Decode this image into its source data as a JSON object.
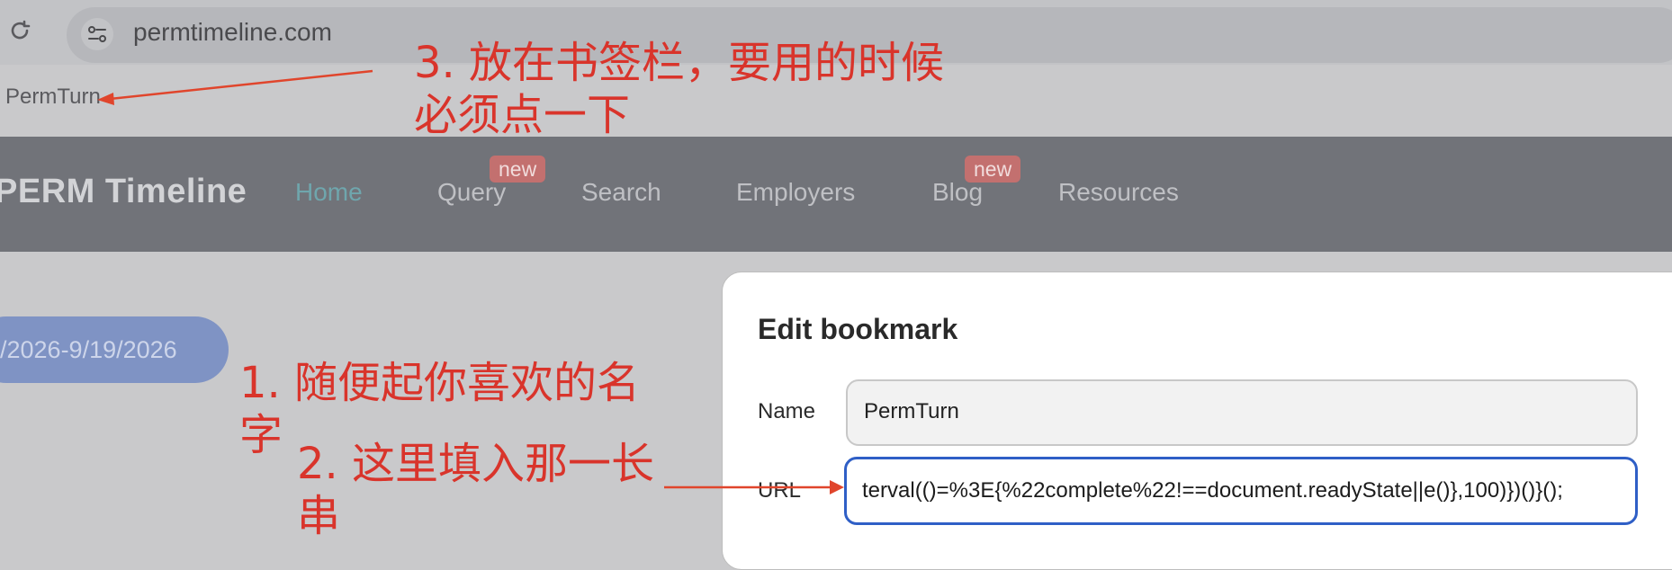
{
  "browser": {
    "address": "permtimeline.com"
  },
  "bookmark_bar": {
    "item_label": "PermTurn"
  },
  "site": {
    "title": "PERM Timeline",
    "nav": {
      "home": "Home",
      "query": "Query",
      "search": "Search",
      "employers": "Employers",
      "blog": "Blog",
      "resources": "Resources"
    },
    "badge_query": "new",
    "badge_blog": "new",
    "date_range": "/2026-9/19/2026"
  },
  "dialog": {
    "title": "Edit bookmark",
    "name_label": "Name",
    "name_value": "PermTurn",
    "url_label": "URL",
    "url_value": "terval(()=%3E{%22complete%22!==document.readyState||e()},100)})()}();"
  },
  "annotations": {
    "note3_line1": "3. 放在书签栏，要用的时候",
    "note3_line2": "必须点一下",
    "note1_line1": "1. 随便起你喜欢的名",
    "note1_line2": "字",
    "note2_line1": "2. 这里填入那一长",
    "note2_line2": "串"
  },
  "colors": {
    "annotation_red": "#d9342b",
    "nav_bg": "#717379",
    "nav_active": "#6fa6ad",
    "badge_bg": "#c3706f",
    "focus_blue": "#2f5fc6"
  }
}
